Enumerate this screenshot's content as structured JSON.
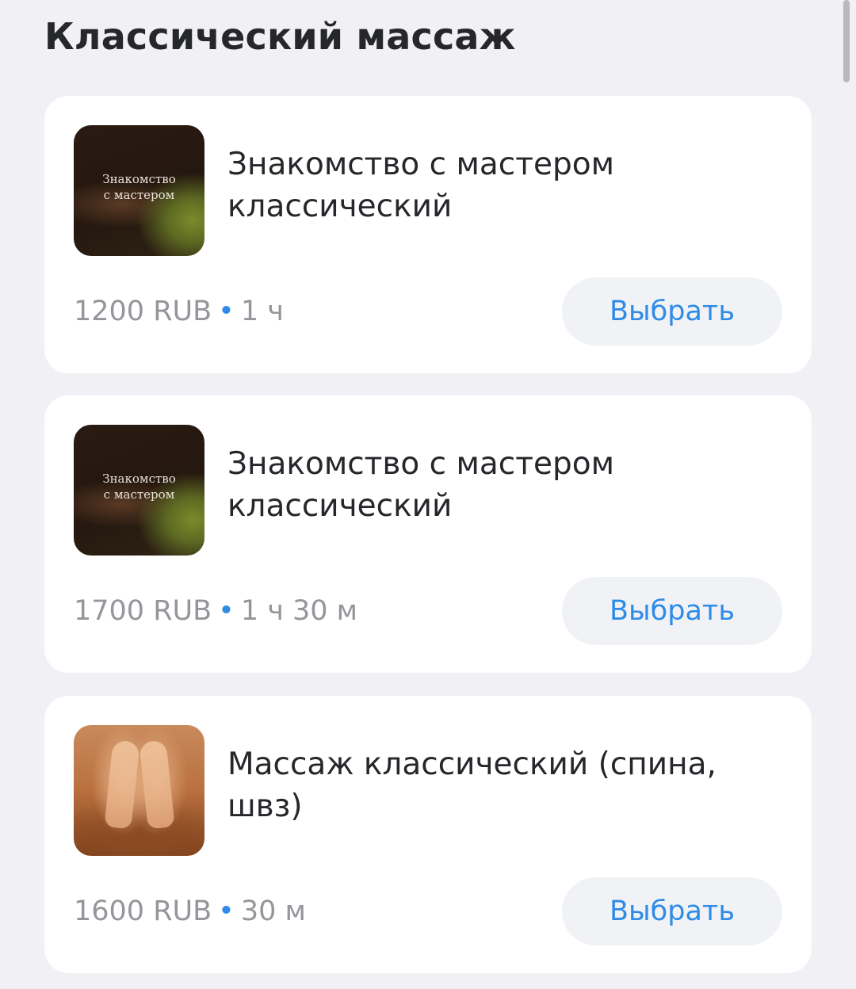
{
  "section": {
    "title": "Классический массаж"
  },
  "services": [
    {
      "thumbnail_icon": "massage-photo-dark",
      "thumbnail_text_line1": "Знакомство",
      "thumbnail_text_line2": "с мастером",
      "name": "Знакомство с мастером классический",
      "price": "1200 RUB",
      "separator": "•",
      "duration": "1 ч",
      "button_label": "Выбрать"
    },
    {
      "thumbnail_icon": "massage-photo-dark",
      "thumbnail_text_line1": "Знакомство",
      "thumbnail_text_line2": "с мастером",
      "name": "Знакомство с мастером классический",
      "price": "1700 RUB",
      "separator": "•",
      "duration": "1 ч 30 м",
      "button_label": "Выбрать"
    },
    {
      "thumbnail_icon": "massage-hands-photo",
      "name": "Массаж классический (спина, швз)",
      "price": "1600 RUB",
      "separator": "•",
      "duration": "30 м",
      "button_label": "Выбрать"
    }
  ],
  "colors": {
    "accent": "#2e8be8",
    "background": "#f0f0f5",
    "card": "#ffffff",
    "button_bg": "#f1f2f6",
    "text_primary": "#26272b",
    "text_secondary": "#95959b"
  }
}
